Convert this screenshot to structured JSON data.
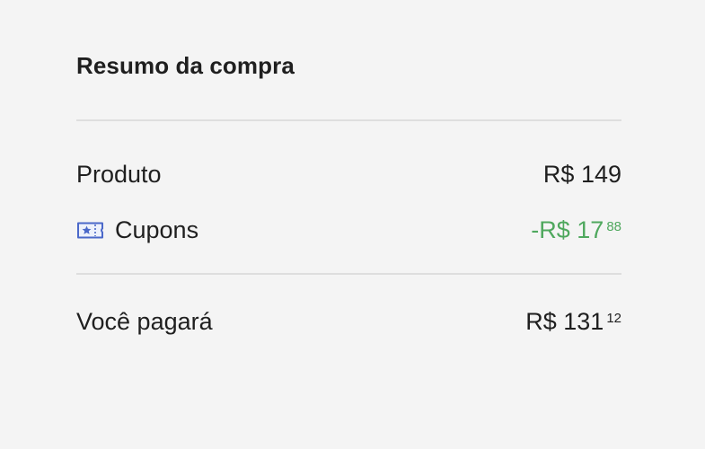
{
  "summary": {
    "title": "Resumo da compra",
    "product": {
      "label": "Produto",
      "value_main": "R$ 149"
    },
    "coupons": {
      "icon": "coupon-ticket-icon",
      "label": "Cupons",
      "value_main": "-R$ 17",
      "value_cents": "88",
      "color": "#4fa85e"
    },
    "total": {
      "label": "Você pagará",
      "value_main": "R$ 131",
      "value_cents": "12"
    }
  }
}
